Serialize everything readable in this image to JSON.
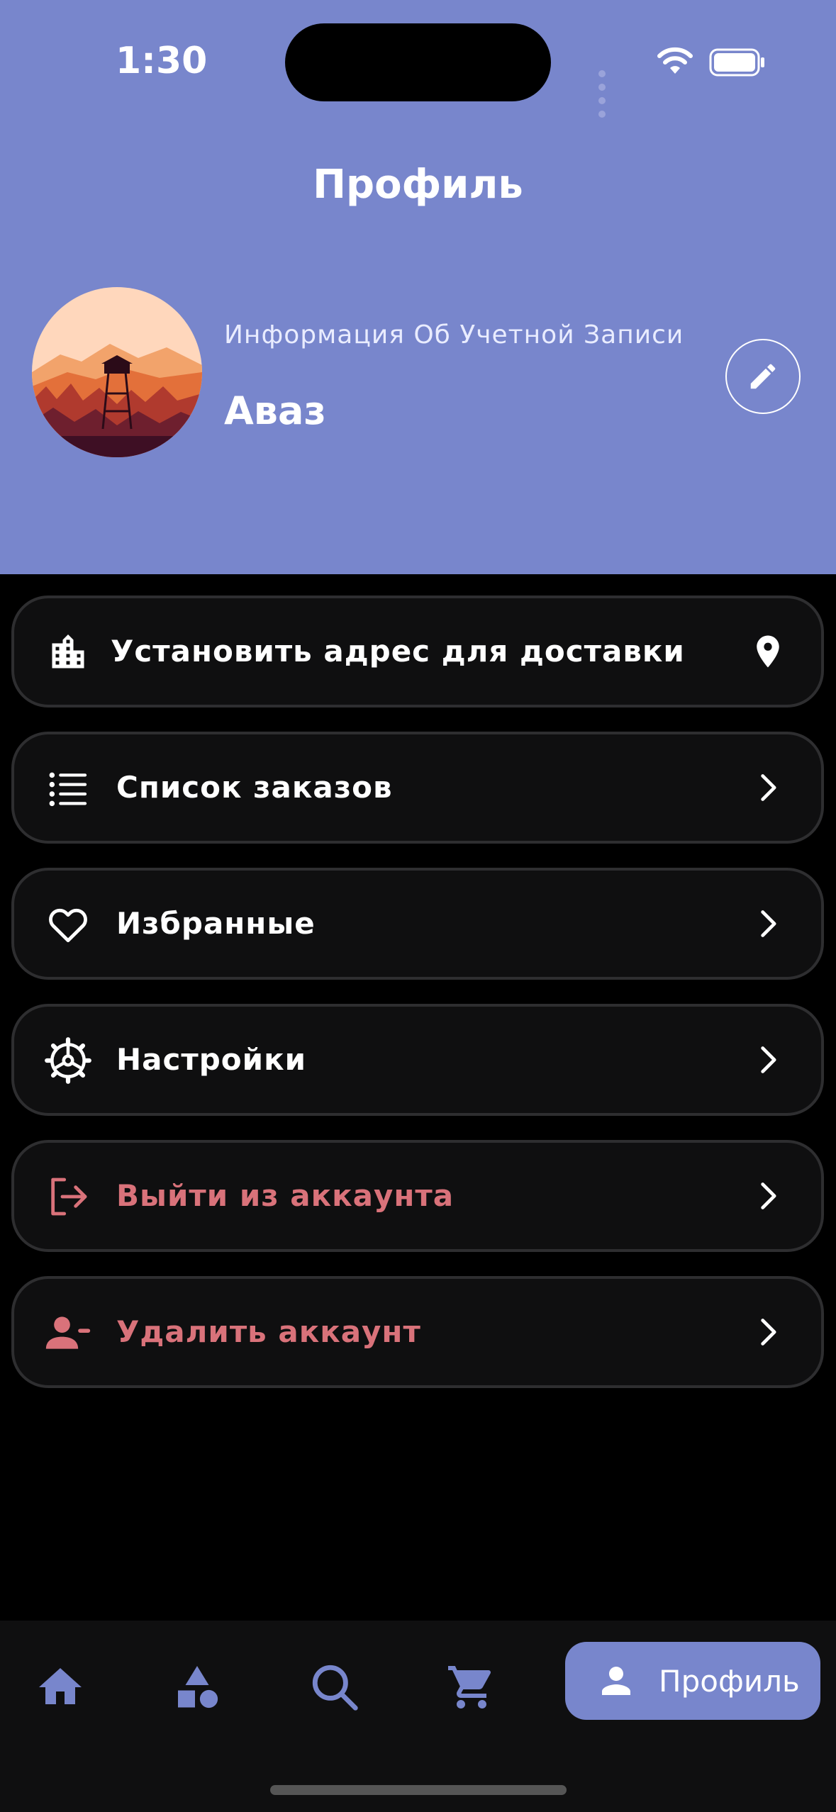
{
  "status_bar": {
    "time": "1:30"
  },
  "header": {
    "title": "Профиль",
    "account_caption": "Информация Об Учетной Записи",
    "account_name": "Аваз"
  },
  "menu": [
    {
      "label": "Установить адрес для доставки",
      "icon": "building-icon",
      "trailing_icon": "location-pin-icon",
      "style": "normal"
    },
    {
      "label": "Список заказов",
      "icon": "list-icon",
      "trailing_icon": "chevron-right-icon",
      "style": "normal"
    },
    {
      "label": "Избранные",
      "icon": "heart-icon",
      "trailing_icon": "chevron-right-icon",
      "style": "normal"
    },
    {
      "label": "Настройки",
      "icon": "gear-icon",
      "trailing_icon": "chevron-right-icon",
      "style": "normal"
    },
    {
      "label": "Выйти из аккаунта",
      "icon": "logout-icon",
      "trailing_icon": "chevron-right-icon",
      "style": "danger"
    },
    {
      "label": "Удалить аккаунт",
      "icon": "person-remove-icon",
      "trailing_icon": "chevron-right-icon",
      "style": "danger"
    }
  ],
  "bottom_nav": {
    "items": [
      "home-icon",
      "categories-icon",
      "search-icon",
      "cart-icon"
    ],
    "active_label": "Профиль"
  },
  "colors": {
    "accent": "#7886CC",
    "danger": "#D9727A",
    "background": "#000000",
    "card": "#0f0f10"
  }
}
